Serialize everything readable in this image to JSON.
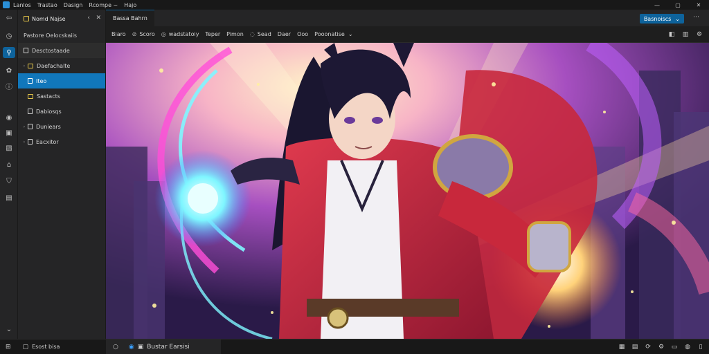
{
  "window": {
    "menu": [
      "Lanlos",
      "Trastao",
      "Dasign",
      "Rcompe ~",
      "Hajo"
    ],
    "controls": {
      "minimize": "—",
      "maximize": "▢",
      "close": "✕"
    }
  },
  "sidebar": {
    "title": "Nomd Najse",
    "header_back": "‹",
    "header_close": "✕",
    "quick": "Pastore Oelocskaiis",
    "section": "Desctostaade",
    "items": [
      {
        "label": "Daefachalte",
        "kind": "folder",
        "chevron": "›"
      },
      {
        "label": "Iteo",
        "kind": "file",
        "chevron": ""
      },
      {
        "label": "Sastacts",
        "kind": "folder",
        "chevron": ""
      },
      {
        "label": "Dabiosqs",
        "kind": "file",
        "chevron": ""
      },
      {
        "label": "Duniears",
        "kind": "file",
        "chevron": "›"
      },
      {
        "label": "Eacxitor",
        "kind": "file",
        "chevron": "›"
      }
    ]
  },
  "tabs": {
    "active": "Bassa Bahrn",
    "primary_button": "Basnoiscs",
    "primary_caret": "⌄"
  },
  "toolbar": {
    "items": [
      {
        "label": "Biaro",
        "icon": ""
      },
      {
        "label": "Scoro",
        "icon": "⊘"
      },
      {
        "label": "wadstatoiy",
        "icon": "◎"
      },
      {
        "label": "Teper",
        "icon": ""
      },
      {
        "label": "Pimon",
        "icon": ""
      },
      {
        "label": "Sead",
        "icon": "◌"
      },
      {
        "label": "Daer",
        "icon": ""
      },
      {
        "label": "Ooo",
        "icon": ""
      },
      {
        "label": "Pooonatise",
        "icon": ""
      }
    ],
    "dropdown_caret": "⌄"
  },
  "status": {
    "start_label": "Esost bisa",
    "panel_label": "Bustar Earsisi"
  },
  "colors": {
    "accent": "#0e639c",
    "selection": "#1177bb",
    "coat_red": "#c8283c",
    "magic_cyan": "#7ff6ff",
    "magic_pink": "#ff4fd8"
  }
}
